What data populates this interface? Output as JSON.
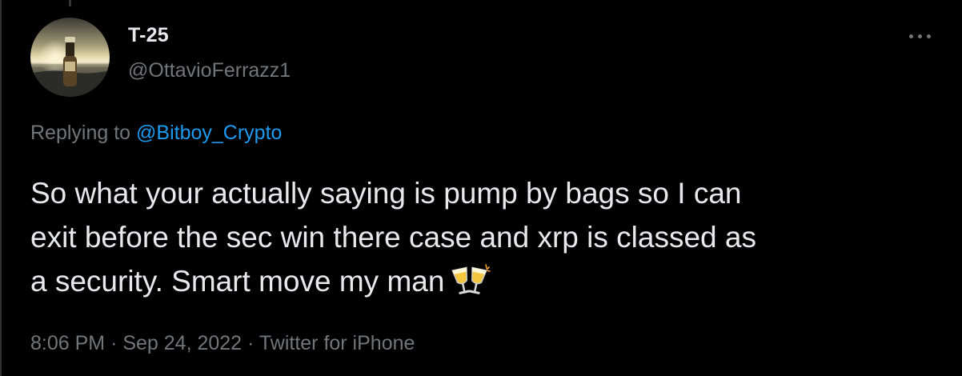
{
  "author": {
    "display_name": "T-25",
    "handle": "@OttavioFerrazz1"
  },
  "reply": {
    "prefix": "Replying to",
    "mention": "@Bitboy_Crypto"
  },
  "tweet": {
    "line1": "So what your actually saying is pump by bags so I can",
    "line2": "exit before the sec win there case and xrp is classed as",
    "line3": "a security. Smart move my man",
    "emoji": "clinking-glasses"
  },
  "meta": {
    "time": "8:06 PM",
    "date": "Sep 24, 2022",
    "source": "Twitter for iPhone",
    "separator": "·"
  },
  "colors": {
    "background": "#000000",
    "primary_text": "#e7e9ea",
    "secondary_text": "#71767b",
    "link": "#1d9bf0"
  }
}
